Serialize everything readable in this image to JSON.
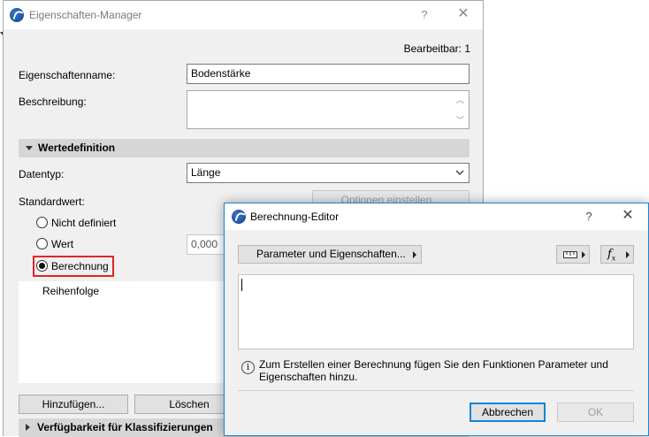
{
  "main": {
    "title": "Eigenschaften-Manager",
    "help": "?",
    "close": "✕",
    "editable": "Bearbeitbar: 1",
    "name_label": "Eigenschaftenname:",
    "name_value": "Bodenstärke",
    "desc_label": "Beschreibung:",
    "desc_value": "",
    "section_values": "Wertedefinition",
    "datatype_label": "Datentyp:",
    "datatype_value": "Länge",
    "default_label": "Standardwert:",
    "options_button": "Optionen einstellen...",
    "radio_undefined": "Nicht definiert",
    "radio_value": "Wert",
    "value_field": "0,000",
    "radio_calc": "Berechnung",
    "order_label": "Reihenfolge",
    "add_button": "Hinzufügen...",
    "delete_button": "Löschen",
    "section_classif": "Verfügbarkeit für Klassifizierungen"
  },
  "editor": {
    "title": "Berechnung-Editor",
    "help": "?",
    "close": "✕",
    "param_button": "Parameter und Eigenschaften...",
    "formula": "",
    "info_icon": "i",
    "info_text": "Zum Erstellen einer Berechnung fügen Sie den Funktionen Parameter und Eigenschaften hinzu.",
    "cancel_button": "Abbrechen",
    "ok_button": "OK"
  },
  "colors": {
    "highlight_red": "#e0242b",
    "focus_blue": "#1883d7"
  }
}
